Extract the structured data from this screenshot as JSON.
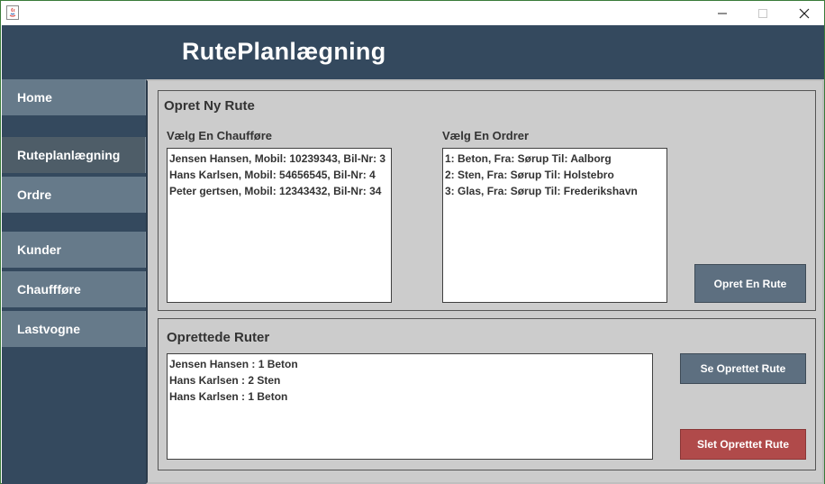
{
  "window": {
    "icon": "java-icon",
    "controls": [
      "minimize-icon",
      "maximize-icon",
      "close-icon"
    ]
  },
  "header": {
    "title": "RutePlanlægning"
  },
  "sidebar": {
    "items": [
      {
        "label": "Home",
        "active": false
      },
      {
        "label": "Ruteplanlægning",
        "active": true
      },
      {
        "label": "Ordre",
        "active": false
      },
      {
        "label": "Kunder",
        "active": false
      },
      {
        "label": "Chauffføre",
        "active": false
      },
      {
        "label": "Lastvogne",
        "active": false
      }
    ]
  },
  "new_route": {
    "title": "Opret Ny Rute",
    "driver_label": "Vælg En Chaufføre",
    "drivers": [
      "Jensen Hansen, Mobil: 10239343, Bil-Nr: 3",
      "Hans Karlsen, Mobil: 54656545, Bil-Nr: 4",
      "Peter gertsen, Mobil: 12343432, Bil-Nr: 34"
    ],
    "order_label": "Vælg En Ordrer",
    "orders": [
      "1: Beton, Fra: Sørup Til: Aalborg",
      "2: Sten, Fra: Sørup Til: Holstebro",
      "3: Glas, Fra: Sørup Til: Frederikshavn"
    ],
    "create_button": "Opret En Rute"
  },
  "created_routes": {
    "title": "Oprettede Ruter",
    "routes": [
      "Jensen Hansen : 1 Beton",
      "Hans Karlsen : 2 Sten",
      "Hans Karlsen : 1 Beton"
    ],
    "view_button": "Se Oprettet Rute",
    "delete_button": "Slet Oprettet Rute"
  },
  "colors": {
    "header_bg": "#34495e",
    "nav_bg": "#667a8a",
    "nav_active_bg": "#4e5d68",
    "content_bg": "#cccccc",
    "button_bg": "#5d6f80",
    "delete_button_bg": "#b04a4a"
  }
}
